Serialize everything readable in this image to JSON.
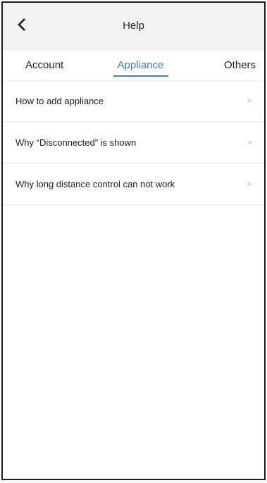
{
  "header": {
    "title": "Help",
    "back_icon": "chevron-left-icon"
  },
  "tabs": [
    {
      "label": "Account",
      "active": false
    },
    {
      "label": "Appliance",
      "active": true
    },
    {
      "label": "Others",
      "active": false
    }
  ],
  "items": [
    {
      "label": "How to add appliance",
      "chevron": ">"
    },
    {
      "label": "Why “Disconnected” is shown",
      "chevron": ">"
    },
    {
      "label": "Why long distance control can not work",
      "chevron": ">"
    }
  ],
  "colors": {
    "accent": "#4b7bc8",
    "header_bg": "#f2f2f2"
  }
}
